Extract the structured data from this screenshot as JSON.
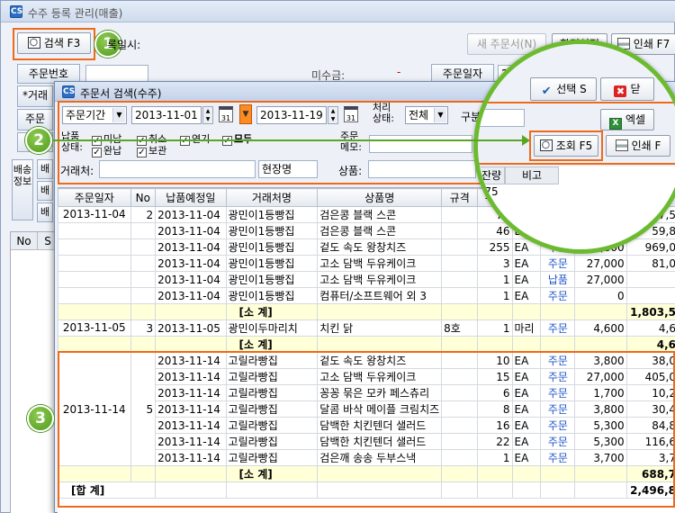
{
  "main": {
    "title": "수주 등록 관리(매출)",
    "search_btn": "검색 F3",
    "reg_date_label": "록일시:",
    "new_order_btn": "새 주문서(N)",
    "settings_btn": "환경설정",
    "print_btn": "인쇄 F7",
    "order_no_label": "주문번호",
    "partner_label": "*거래",
    "order_label": "주문",
    "ship_info_label": "배송정보",
    "col_no": "No",
    "col_s": "S",
    "misc1": "미수금:",
    "misc2": "주문일자",
    "misc3": "20"
  },
  "dialog": {
    "title": "주문서 검색(수주)",
    "period_select": "주문기간",
    "date_from": "2013-11-01",
    "date_to": "2013-11-19",
    "status_label_1": "처리",
    "status_label_2": "상태:",
    "status_select": "전체",
    "category_label": "구분",
    "delivery_label": "납품",
    "state_label": "상태:",
    "chk_unpaid": "미납",
    "chk_cancel": "취소",
    "chk_delay": "연기",
    "chk_all": "모두",
    "chk_complete": "완납",
    "chk_hold": "보관",
    "order_label": "주문",
    "memo_label": "메모:",
    "partner_label": "거래처:",
    "site_label": "현장명",
    "product_label": "상품:",
    "select_btn": "선택 S",
    "cancel_btn": "닫",
    "excel_btn": "엑셀",
    "query_btn": "조회 F5",
    "print_btn": "인쇄 F",
    "remain_header": "잔량",
    "note_header": "비고",
    "remain_value": "75",
    "side_labels": [
      "주",
      "배"
    ],
    "mag_glimpse": "림"
  },
  "steps": [
    "1",
    "2",
    "3"
  ],
  "table": {
    "headers": [
      "주문일자",
      "No",
      "납품예정일",
      "거래처명",
      "상품명",
      "규격",
      "수량",
      "",
      "",
      "금액"
    ],
    "rows": [
      {
        "date": "2013-11-04",
        "no": "2",
        "ddate": "2013-11-04",
        "partner": "광민이1등빵집",
        "product": "검은콩 블랙 스콘",
        "spec": "",
        "qty": "75",
        "unit": "EA",
        "status": "주문",
        "price": "3,800",
        "amount": "97,5"
      },
      {
        "date": "",
        "no": "",
        "ddate": "2013-11-04",
        "partner": "광민이1등빵집",
        "product": "검은콩 블랙 스콘",
        "spec": "",
        "qty": "46",
        "unit": "EA",
        "status": "주문",
        "price": "3,800",
        "amount": "59,8"
      },
      {
        "date": "",
        "no": "",
        "ddate": "2013-11-04",
        "partner": "광민이1등빵집",
        "product": "겉도 속도 왕창치즈",
        "spec": "",
        "qty": "255",
        "unit": "EA",
        "status": "주문",
        "price": "3,800",
        "amount": "969,0"
      },
      {
        "date": "",
        "no": "",
        "ddate": "2013-11-04",
        "partner": "광민이1등빵집",
        "product": "고소 담백 두유케이크",
        "spec": "",
        "qty": "3",
        "unit": "EA",
        "status": "주문",
        "price": "27,000",
        "amount": "81,0"
      },
      {
        "date": "",
        "no": "",
        "ddate": "2013-11-04",
        "partner": "광민이1등빵집",
        "product": "고소 담백 두유케이크",
        "spec": "",
        "qty": "1",
        "unit": "EA",
        "status": "납품",
        "price": "27,000",
        "amount": ""
      },
      {
        "date": "",
        "no": "",
        "ddate": "2013-11-04",
        "partner": "광민이1등빵집",
        "product": "컴퓨터/소프트웨어 외 3",
        "spec": "",
        "qty": "1",
        "unit": "EA",
        "status": "주문",
        "price": "0",
        "amount": ""
      }
    ],
    "subtotal_1": {
      "label": "[소 계]",
      "amount": "1,803,5"
    },
    "rows2": [
      {
        "date": "2013-11-05",
        "no": "3",
        "ddate": "2013-11-05",
        "partner": "광민이두마리치",
        "product": "치킨 닭",
        "spec": "8호",
        "qty": "1",
        "unit": "마리",
        "status": "주문",
        "price": "4,600",
        "amount": "4,6"
      }
    ],
    "subtotal_2": {
      "label": "[소 계]",
      "amount": "4,6"
    },
    "group3": {
      "date": "2013-11-14",
      "no": "5"
    },
    "rows3": [
      {
        "ddate": "2013-11-14",
        "partner": "고릴라빵집",
        "product": "겉도 속도 왕창치즈",
        "spec": "",
        "qty": "10",
        "unit": "EA",
        "status": "주문",
        "price": "3,800",
        "amount": "38,0"
      },
      {
        "ddate": "2013-11-14",
        "partner": "고릴라빵집",
        "product": "고소 담백 두유케이크",
        "spec": "",
        "qty": "15",
        "unit": "EA",
        "status": "주문",
        "price": "27,000",
        "amount": "405,0"
      },
      {
        "ddate": "2013-11-14",
        "partner": "고릴라빵집",
        "product": "꽁꽁 묶은 모카 페스츄리",
        "spec": "",
        "qty": "6",
        "unit": "EA",
        "status": "주문",
        "price": "1,700",
        "amount": "10,2"
      },
      {
        "ddate": "2013-11-14",
        "partner": "고릴라빵집",
        "product": "달콤 바삭 메이플 크림치즈",
        "spec": "",
        "qty": "8",
        "unit": "EA",
        "status": "주문",
        "price": "3,800",
        "amount": "30,4"
      },
      {
        "ddate": "2013-11-14",
        "partner": "고릴라빵집",
        "product": "담백한 치킨텐더 샐러드",
        "spec": "",
        "qty": "16",
        "unit": "EA",
        "status": "주문",
        "price": "5,300",
        "amount": "84,8"
      },
      {
        "ddate": "2013-11-14",
        "partner": "고릴라빵집",
        "product": "담백한 치킨텐더 샐러드",
        "spec": "",
        "qty": "22",
        "unit": "EA",
        "status": "주문",
        "price": "5,300",
        "amount": "116,6"
      },
      {
        "ddate": "2013-11-14",
        "partner": "고릴라빵집",
        "product": "검은깨 송송 두부스낵",
        "spec": "",
        "qty": "1",
        "unit": "EA",
        "status": "주문",
        "price": "3,700",
        "amount": "3,7"
      }
    ],
    "subtotal_3": {
      "label": "[소 계]",
      "amount": "688,7"
    },
    "grand_total": {
      "label": "[합 계]",
      "amount": "2,496,8"
    }
  },
  "colors": {
    "highlight": "#ee6a1a",
    "step_green": "#5aa623",
    "status_blue": "#1f55c8"
  }
}
